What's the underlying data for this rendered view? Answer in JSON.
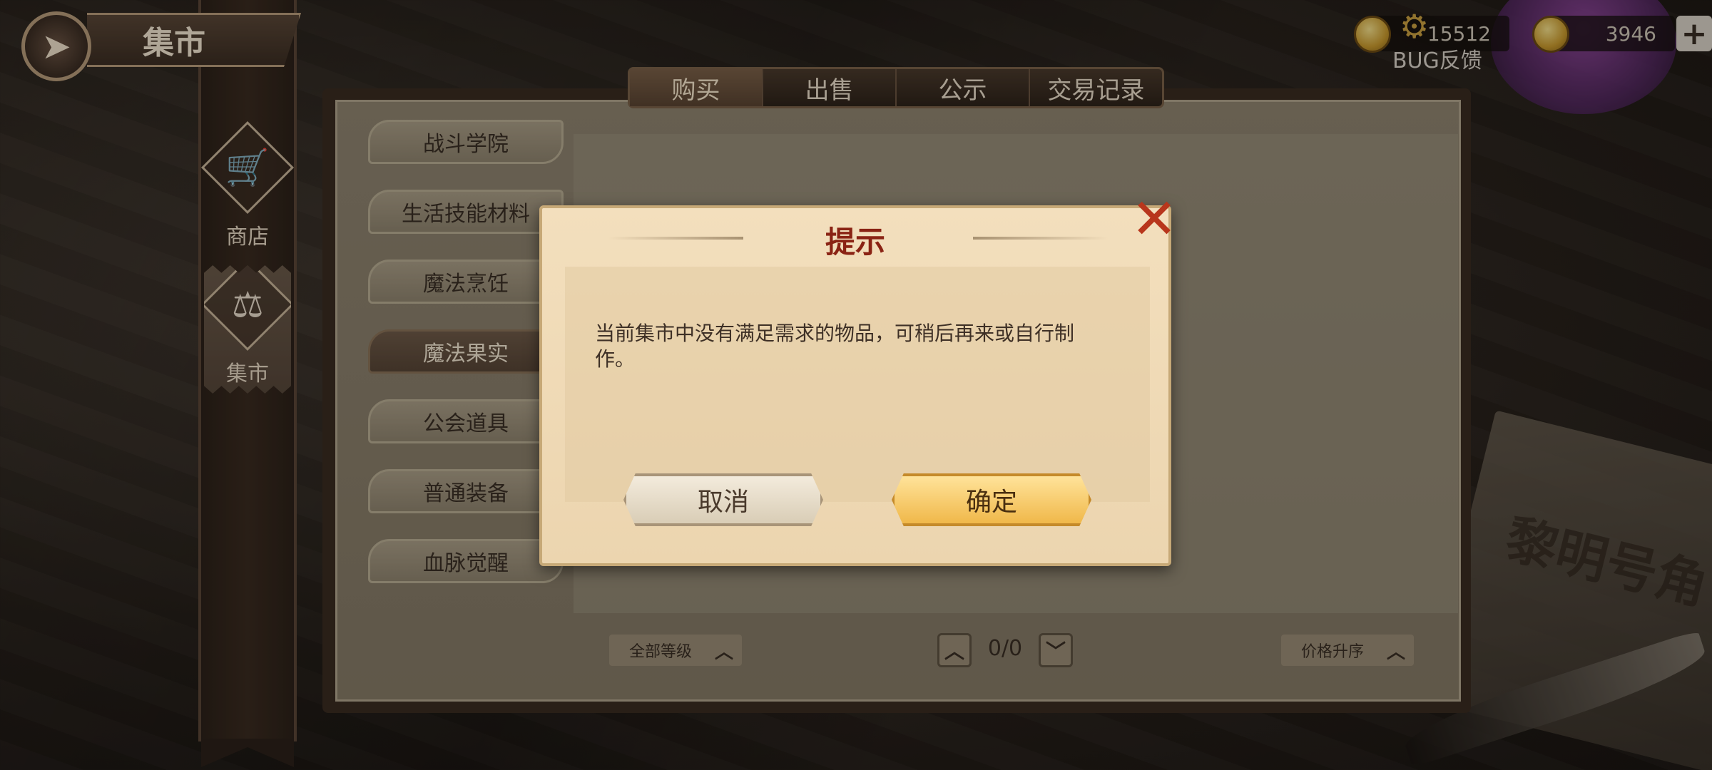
{
  "header": {
    "title": "集市",
    "back_icon": "back-arrow-icon"
  },
  "currency": {
    "gold_value": "15512",
    "diamond_value": "3946",
    "bug_feedback": "BUG反馈"
  },
  "sidebar": {
    "items": [
      {
        "label": "商店",
        "icon": "cart-icon"
      },
      {
        "label": "集市",
        "icon": "scales-icon"
      }
    ]
  },
  "tabs": [
    "购买",
    "出售",
    "公示",
    "交易记录"
  ],
  "categories": [
    "战斗学院",
    "生活技能材料",
    "魔法烹饪",
    "魔法果实",
    "公会道具",
    "普通装备",
    "血脉觉醒"
  ],
  "filters": {
    "level_filter": "全部等级",
    "sort": "价格升序",
    "page_indicator": "0/0"
  },
  "dialog": {
    "title": "提示",
    "message": "当前集市中没有满足需求的物品，可稍后再来或自行制作。",
    "cancel_label": "取消",
    "confirm_label": "确定"
  },
  "background": {
    "paper_text": "黎明号角"
  },
  "colors": {
    "accent_red": "#8a2314",
    "confirm_gold": "#f0b84a",
    "panel_brown": "#3a2b20"
  }
}
